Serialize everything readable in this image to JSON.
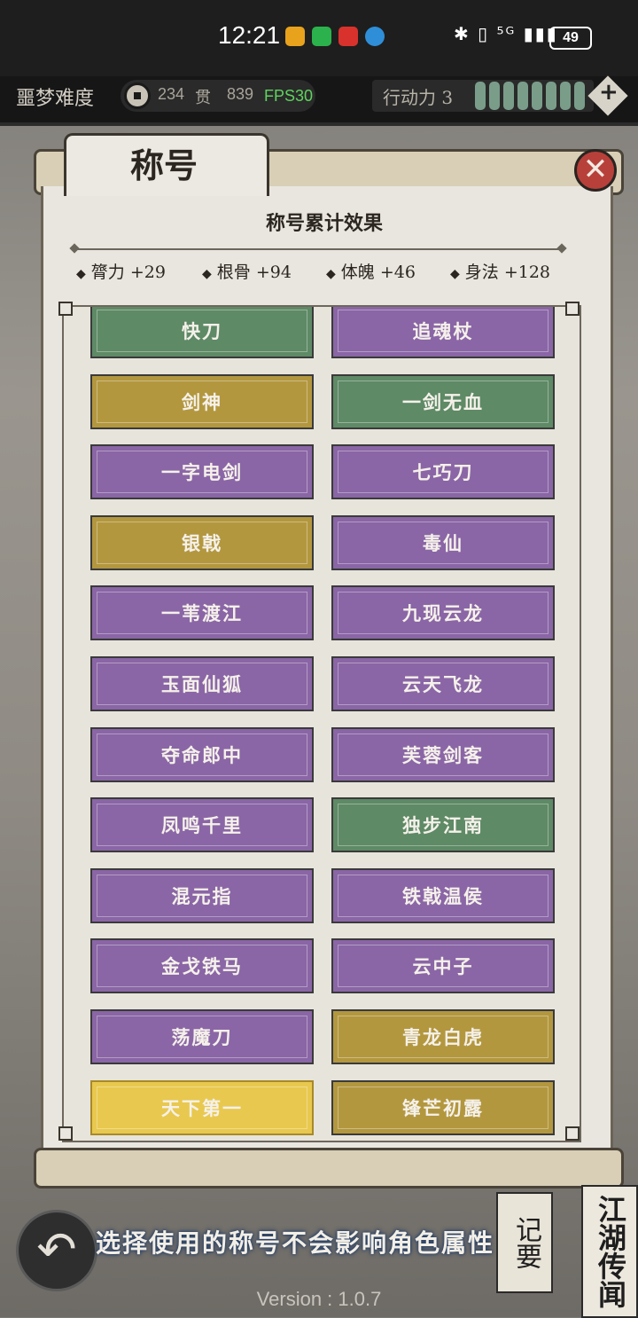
{
  "status_bar": {
    "time": "12:21",
    "icons": "✱ ▯ ⁵ᴳ ▮▮▮",
    "battery": "49"
  },
  "topbar": {
    "difficulty": "噩梦难度",
    "coin_amount": "234",
    "coin_unit": "贯",
    "coin_amount_2": "839",
    "fps": "FPS30",
    "action_label": "行动力 3",
    "action_pips_filled": 8,
    "plus_label": "+"
  },
  "panel": {
    "tab_title": "称号",
    "close_label": "✕",
    "effect_title": "称号累计效果",
    "stats": [
      {
        "label": "膂力 +29"
      },
      {
        "label": "根骨 +94"
      },
      {
        "label": "体魄 +46"
      },
      {
        "label": "身法 +128"
      }
    ]
  },
  "titles": [
    {
      "name": "快刀",
      "color": "green"
    },
    {
      "name": "追魂杖",
      "color": "purple"
    },
    {
      "name": "剑神",
      "color": "gold"
    },
    {
      "name": "一剑无血",
      "color": "green"
    },
    {
      "name": "一字电剑",
      "color": "purple"
    },
    {
      "name": "七巧刀",
      "color": "purple"
    },
    {
      "name": "银戟",
      "color": "gold"
    },
    {
      "name": "毒仙",
      "color": "purple"
    },
    {
      "name": "一苇渡江",
      "color": "purple"
    },
    {
      "name": "九现云龙",
      "color": "purple"
    },
    {
      "name": "玉面仙狐",
      "color": "purple"
    },
    {
      "name": "云天飞龙",
      "color": "purple"
    },
    {
      "name": "夺命郎中",
      "color": "purple"
    },
    {
      "name": "芙蓉剑客",
      "color": "purple"
    },
    {
      "name": "凤鸣千里",
      "color": "purple"
    },
    {
      "name": "独步江南",
      "color": "green"
    },
    {
      "name": "混元指",
      "color": "purple"
    },
    {
      "name": "铁戟温侯",
      "color": "purple"
    },
    {
      "name": "金戈铁马",
      "color": "purple"
    },
    {
      "name": "云中子",
      "color": "purple"
    },
    {
      "name": "荡魔刀",
      "color": "purple"
    },
    {
      "name": "青龙白虎",
      "color": "gold"
    },
    {
      "name": "天下第一",
      "color": "bright"
    },
    {
      "name": "锋芒初露",
      "color": "gold"
    }
  ],
  "bottom": {
    "back_label": "↶",
    "hint": "选择使用的称号不会影响角色属性",
    "memo_label": "记要",
    "rumor_label": "江湖传闻",
    "version": "Version : 1.0.7"
  }
}
